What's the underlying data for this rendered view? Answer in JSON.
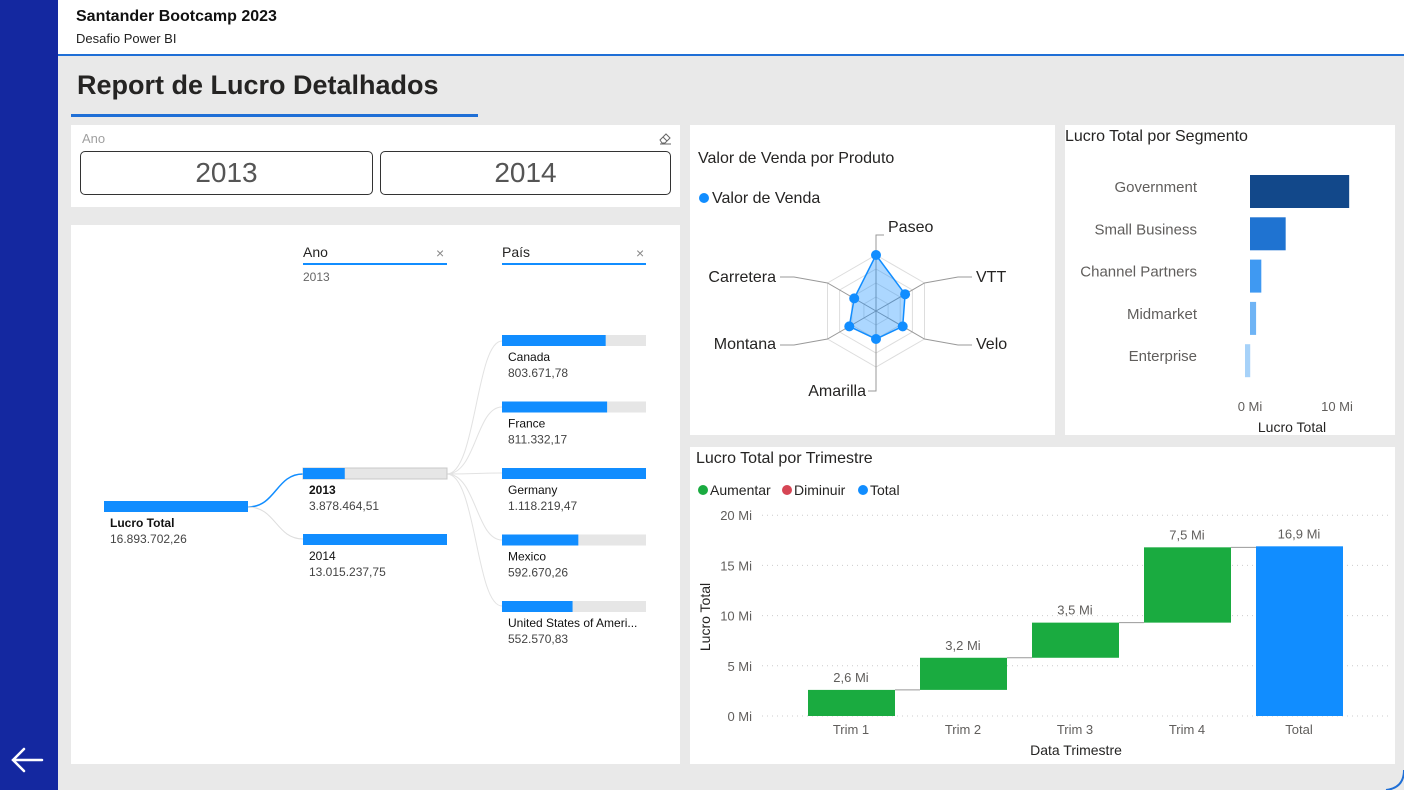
{
  "header": {
    "title": "Santander Bootcamp 2023",
    "subtitle": "Desafio Power BI"
  },
  "report_title": "Report de Lucro Detalhados",
  "slicer": {
    "label": "Ano",
    "options": [
      "2013",
      "2014"
    ]
  },
  "decomp_tree": {
    "root": {
      "label": "Lucro Total",
      "value": "16.893.702,26"
    },
    "level1": {
      "header": "Ano",
      "selected": "2013",
      "items": [
        {
          "label": "2013",
          "value": "3.878.464,51",
          "fill": 0.29
        },
        {
          "label": "2014",
          "value": "13.015.237,75",
          "fill": 1.0
        }
      ]
    },
    "level2": {
      "header": "País",
      "items": [
        {
          "label": "Canada",
          "value": "803.671,78",
          "fill": 0.72
        },
        {
          "label": "France",
          "value": "811.332,17",
          "fill": 0.73
        },
        {
          "label": "Germany",
          "value": "1.118.219,47",
          "fill": 1.0
        },
        {
          "label": "Mexico",
          "value": "592.670,26",
          "fill": 0.53
        },
        {
          "label": "United States of Ameri...",
          "value": "552.570,83",
          "fill": 0.49
        }
      ]
    }
  },
  "radar": {
    "title": "Valor de Venda por Produto",
    "legend": "Valor de Venda",
    "color": "#118dff"
  },
  "segment": {
    "title": "Lucro Total por Segmento",
    "xlabel": "Lucro Total",
    "ticks": [
      "0 Mi",
      "10 Mi"
    ]
  },
  "waterfall": {
    "title": "Lucro Total por Trimestre",
    "legend": [
      "Aumentar",
      "Diminuir",
      "Total"
    ],
    "legend_colors": [
      "#1aab40",
      "#d64554",
      "#118dff"
    ],
    "xlabel": "Data Trimestre",
    "ylabel": "Lucro Total",
    "yticks": [
      "20 Mi",
      "15 Mi",
      "10 Mi",
      "5 Mi",
      "0 Mi"
    ]
  },
  "chart_data": [
    {
      "type": "radar",
      "title": "Valor de Venda por Produto",
      "categories": [
        "Paseo",
        "VTT",
        "Velo",
        "Amarilla",
        "Montana",
        "Carretera"
      ],
      "series": [
        {
          "name": "Valor de Venda",
          "values": [
            1.0,
            0.6,
            0.55,
            0.5,
            0.55,
            0.45
          ]
        }
      ]
    },
    {
      "type": "bar",
      "title": "Lucro Total por Segmento",
      "categories": [
        "Government",
        "Small Business",
        "Channel Partners",
        "Midmarket",
        "Enterprise"
      ],
      "values": [
        11.4,
        4.1,
        1.3,
        0.7,
        0.6
      ],
      "xlabel": "Lucro Total",
      "xlim": [
        0,
        12
      ],
      "unit": "Mi"
    },
    {
      "type": "waterfall",
      "title": "Lucro Total por Trimestre",
      "categories": [
        "Trim 1",
        "Trim 2",
        "Trim 3",
        "Trim 4",
        "Total"
      ],
      "values": [
        2.6,
        3.2,
        3.5,
        7.5,
        16.9
      ],
      "labels": [
        "2,6 Mi",
        "3,2 Mi",
        "3,5 Mi",
        "7,5 Mi",
        "16,9 Mi"
      ],
      "xlabel": "Data Trimestre",
      "ylabel": "Lucro Total",
      "ylim": [
        0,
        20
      ]
    }
  ]
}
